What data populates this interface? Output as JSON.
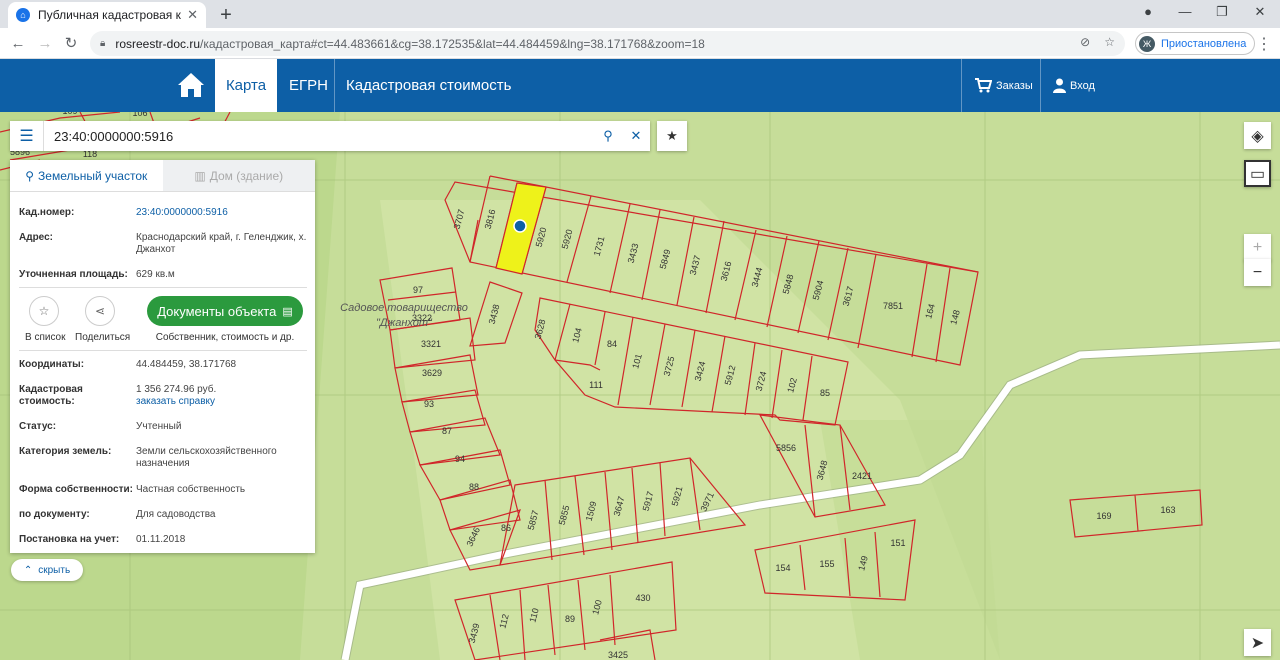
{
  "browser": {
    "tab_title": "Публичная кадастровая карта",
    "url_host": "rosreestr-doc.ru",
    "url_path": "/кадастровая_карта#ct=44.483661&cg=38.172535&lat=44.484459&lng=38.171768&zoom=18",
    "profile_initial": "Ж",
    "profile_label": "Приостановлена"
  },
  "header": {
    "nav": [
      "Карта",
      "ЕГРН",
      "Кадастровая стоимость"
    ],
    "orders": "Заказы",
    "login": "Вход"
  },
  "search": {
    "value": "23:40:0000000:5916"
  },
  "panel": {
    "tab_land": "Земельный участок",
    "tab_house": "Дом (здание)",
    "cad_label": "Кад.номер:",
    "cad_value": "23:40:0000000:5916",
    "addr_label": "Адрес:",
    "addr_value": "Краснодарский край, г. Геленджик, х. Джанхот",
    "area_label": "Уточненная площадь:",
    "area_value": "629 кв.м",
    "to_list": "В список",
    "share": "Поделиться",
    "docs_button": "Документы объекта",
    "docs_sub": "Собственник, стоимость и др.",
    "coords_label": "Координаты:",
    "coords_value": "44.484459, 38.171768",
    "cost_label": "Кадастровая стоимость:",
    "cost_value": "1 356 274.96 руб.",
    "cost_link": "заказать справку",
    "status_label": "Статус:",
    "status_value": "Учтенный",
    "category_label": "Категория земель:",
    "category_value": "Земли сельскохозяйственного назначения",
    "ownership_label": "Форма собственности:",
    "ownership_value": "Частная собственность",
    "bydoc_label": "по документу:",
    "bydoc_value": "Для садоводства",
    "reg_label": "Постановка на учет:",
    "reg_value": "01.11.2018",
    "hide": "скрыть"
  },
  "map": {
    "place_name_1": "Садовое товарищество",
    "place_name_2": "\"Джанхот\"",
    "parcel_labels": [
      "109",
      "106",
      "118",
      "5896",
      "3707",
      "3816",
      "5920",
      "5920",
      "1731",
      "3433",
      "5849",
      "3437",
      "3616",
      "3444",
      "5848",
      "5904",
      "3617",
      "7851",
      "164",
      "148",
      "97",
      "3322",
      "3438",
      "3628",
      "104",
      "84",
      "101",
      "3725",
      "3424",
      "5912",
      "3724",
      "102",
      "85",
      "111",
      "3321",
      "3629",
      "93",
      "87",
      "94",
      "88",
      "3646",
      "86",
      "5857",
      "5855",
      "1509",
      "3647",
      "5917",
      "5921",
      "3971",
      "5856",
      "3648",
      "2421",
      "169",
      "163",
      "154",
      "155",
      "149",
      "151",
      "3439",
      "112",
      "110",
      "89",
      "100",
      "430",
      "3425"
    ]
  },
  "colors": {
    "header": "#0d5fa6",
    "map_bg": "#bcd88d",
    "parcel_stroke": "#d0262a",
    "selected_fill": "#eef21a",
    "button_green": "#2b9a3e"
  }
}
